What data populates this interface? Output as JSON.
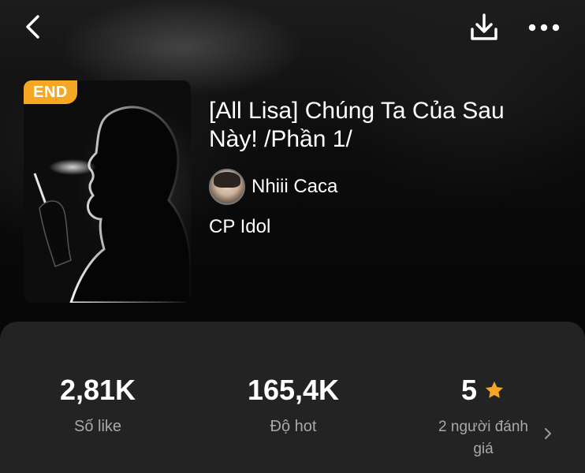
{
  "header": {
    "back_icon": "chevron-left-icon",
    "download_icon": "download-icon",
    "more_icon": "more-horizontal-icon"
  },
  "story": {
    "badge": "END",
    "title": "[All Lisa] Chúng Ta Của Sau Này! /Phần 1/",
    "author": "Nhiii Caca",
    "category": "CP Idol"
  },
  "stats": {
    "likes_value": "2,81K",
    "likes_label": "Số like",
    "hot_value": "165,4K",
    "hot_label": "Độ hot",
    "rating_value": "5",
    "rating_label": "2 người đánh giá"
  },
  "colors": {
    "accent": "#f5a623",
    "panel": "#232323",
    "muted_text": "#a9a9a9"
  }
}
